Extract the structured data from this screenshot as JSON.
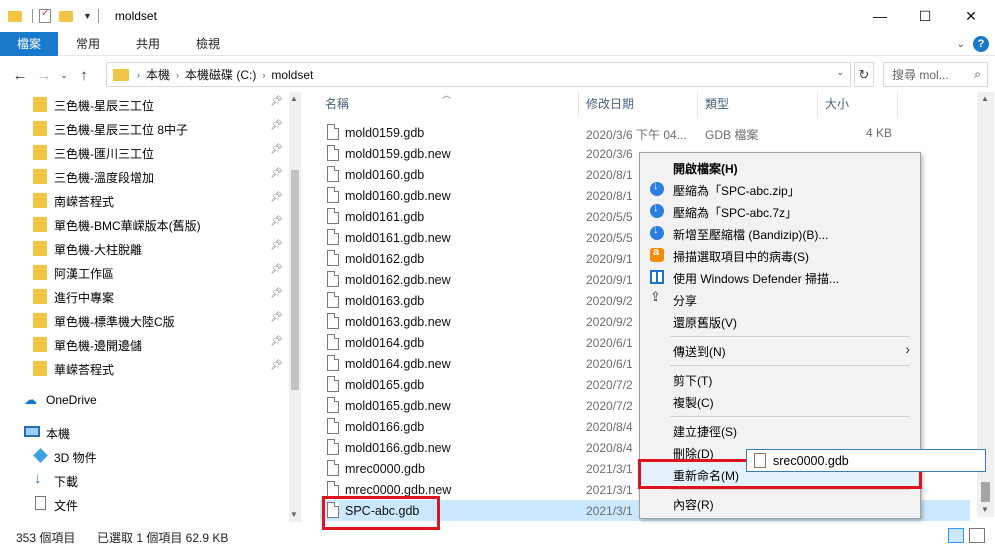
{
  "window": {
    "title": "moldset",
    "minimize": "—",
    "maximize": "☐",
    "close": "✕"
  },
  "ribbon": {
    "tabs": [
      "檔案",
      "常用",
      "共用",
      "檢視"
    ]
  },
  "address": {
    "breadcrumb": [
      "本機",
      "本機磁碟 (C:)",
      "moldset"
    ],
    "search_placeholder": "搜尋 mol..."
  },
  "nav_pane": {
    "quick_access": [
      {
        "label": "三色機-星辰三工位",
        "pinned": true
      },
      {
        "label": "三色機-星辰三工位 8中子",
        "pinned": true
      },
      {
        "label": "三色機-匯川三工位",
        "pinned": true
      },
      {
        "label": "三色機-溫度段增加",
        "pinned": true
      },
      {
        "label": "南嵘荅程式",
        "pinned": true
      },
      {
        "label": "單色機-BMC華嵘版本(舊版)",
        "pinned": true
      },
      {
        "label": "單色機-大柱脫離",
        "pinned": true
      },
      {
        "label": "阿漢工作區",
        "pinned": true
      },
      {
        "label": "進行中專案",
        "pinned": true
      },
      {
        "label": "單色機-標準機大陸C版",
        "pinned": true
      },
      {
        "label": "單色機-邊開邊儲",
        "pinned": true
      },
      {
        "label": "華嵘荅程式",
        "pinned": true
      }
    ],
    "onedrive": "OneDrive",
    "this_pc": "本機",
    "pc_items": [
      "3D 物件",
      "下載",
      "文件"
    ]
  },
  "columns": {
    "name": "名稱",
    "date": "修改日期",
    "type": "類型",
    "size": "大小"
  },
  "files": [
    {
      "name": "mold0159.gdb",
      "date": "2020/3/6 下午 04...",
      "type": "GDB 檔案",
      "size": "4 KB"
    },
    {
      "name": "mold0159.gdb.new",
      "date": "2020/3/6",
      "type": "",
      "size": ""
    },
    {
      "name": "mold0160.gdb",
      "date": "2020/8/1",
      "type": "",
      "size": ""
    },
    {
      "name": "mold0160.gdb.new",
      "date": "2020/8/1",
      "type": "",
      "size": ""
    },
    {
      "name": "mold0161.gdb",
      "date": "2020/5/5",
      "type": "",
      "size": ""
    },
    {
      "name": "mold0161.gdb.new",
      "date": "2020/5/5",
      "type": "",
      "size": ""
    },
    {
      "name": "mold0162.gdb",
      "date": "2020/9/1",
      "type": "",
      "size": ""
    },
    {
      "name": "mold0162.gdb.new",
      "date": "2020/9/1",
      "type": "",
      "size": ""
    },
    {
      "name": "mold0163.gdb",
      "date": "2020/9/2",
      "type": "",
      "size": ""
    },
    {
      "name": "mold0163.gdb.new",
      "date": "2020/9/2",
      "type": "",
      "size": ""
    },
    {
      "name": "mold0164.gdb",
      "date": "2020/6/1",
      "type": "",
      "size": ""
    },
    {
      "name": "mold0164.gdb.new",
      "date": "2020/6/1",
      "type": "",
      "size": ""
    },
    {
      "name": "mold0165.gdb",
      "date": "2020/7/2",
      "type": "",
      "size": ""
    },
    {
      "name": "mold0165.gdb.new",
      "date": "2020/7/2",
      "type": "",
      "size": ""
    },
    {
      "name": "mold0166.gdb",
      "date": "2020/8/4",
      "type": "",
      "size": ""
    },
    {
      "name": "mold0166.gdb.new",
      "date": "2020/8/4",
      "type": "",
      "size": ""
    },
    {
      "name": "mrec0000.gdb",
      "date": "2021/3/1",
      "type": "",
      "size": ""
    },
    {
      "name": "mrec0000.gdb.new",
      "date": "2021/3/1",
      "type": "",
      "size": ""
    },
    {
      "name": "SPC-abc.gdb",
      "date": "2021/3/1",
      "type": "",
      "size": "",
      "selected": true
    }
  ],
  "context_menu": {
    "open": "開啟檔案(H)",
    "zip": "壓縮為「SPC-abc.zip」",
    "sevenz": "壓縮為「SPC-abc.7z」",
    "add_archive": "新增至壓縮檔 (Bandizip)(B)...",
    "scan": "掃描選取項目中的病毒(S)",
    "defender": "使用 Windows Defender 掃描...",
    "share": "分享",
    "restore": "還原舊版(V)",
    "send_to": "傳送到(N)",
    "cut": "剪下(T)",
    "copy": "複製(C)",
    "shortcut": "建立捷徑(S)",
    "delete": "刪除(D)",
    "rename": "重新命名(M)",
    "properties": "內容(R)"
  },
  "rename_box": {
    "value": "srec0000.gdb"
  },
  "status_bar": {
    "count": "353 個項目",
    "selection": "已選取 1 個項目 62.9 KB"
  },
  "colors": {
    "accent": "#1979ca",
    "selection": "#cce8ff",
    "highlight_box": "#e0141e",
    "folder": "#f3c545"
  }
}
